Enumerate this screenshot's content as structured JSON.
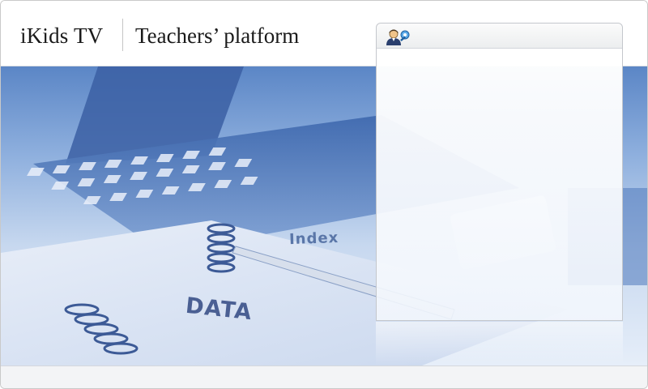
{
  "header": {
    "brand": "iKids TV",
    "platform_title": "Teachers’ platform"
  },
  "hero": {
    "notebook_label_index": "Index",
    "notebook_label_data": "DATA"
  },
  "login_panel": {
    "icon": "user-key-icon"
  },
  "colors": {
    "hero_blue": "#5b86c6",
    "header_text": "#1a1a1a"
  }
}
